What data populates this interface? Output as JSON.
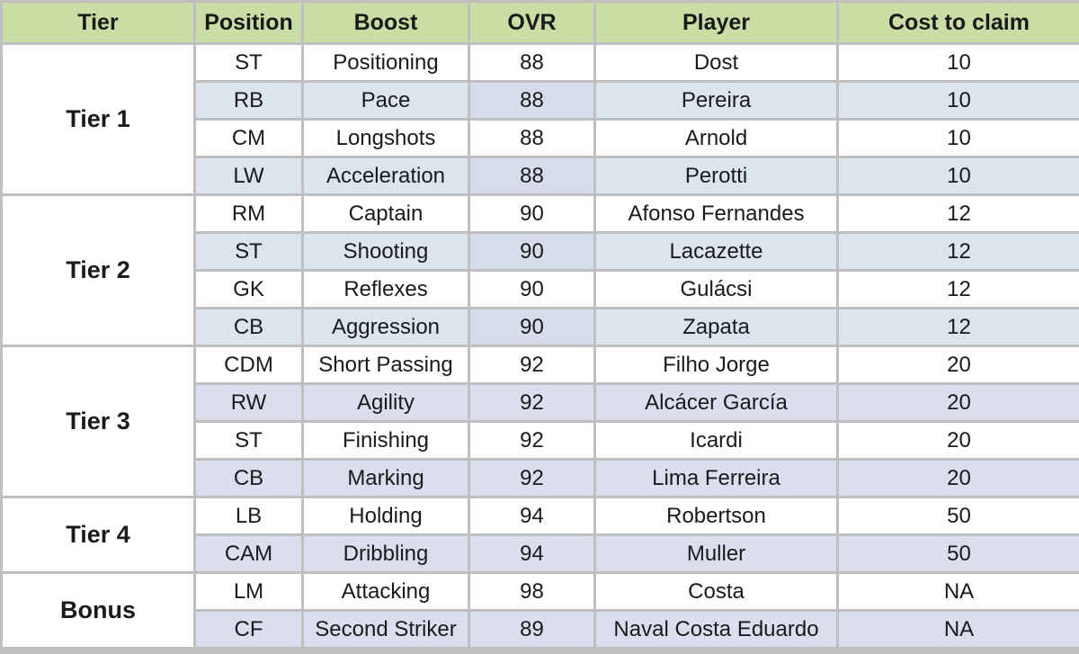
{
  "table": {
    "columns": [
      {
        "key": "tier",
        "label": "Tier"
      },
      {
        "key": "position",
        "label": "Position"
      },
      {
        "key": "boost",
        "label": "Boost"
      },
      {
        "key": "ovr",
        "label": "OVR"
      },
      {
        "key": "player",
        "label": "Player"
      },
      {
        "key": "cost",
        "label": "Cost to claim"
      }
    ],
    "header_bg": "#c9dda4",
    "grid_color": "#bfbfbf",
    "row_white_bg": "#ffffff",
    "row_alt_bg_tier12": "#dce4ed",
    "row_alt_bg_tier345": "#dadeef",
    "groups": [
      {
        "tier": "Tier 1",
        "rows": [
          {
            "position": "ST",
            "boost": "Positioning",
            "ovr": "88",
            "player": "Dost",
            "cost": "10"
          },
          {
            "position": "RB",
            "boost": "Pace",
            "ovr": "88",
            "player": "Pereira",
            "cost": "10"
          },
          {
            "position": "CM",
            "boost": "Longshots",
            "ovr": "88",
            "player": "Arnold",
            "cost": "10"
          },
          {
            "position": "LW",
            "boost": "Acceleration",
            "ovr": "88",
            "player": "Perotti",
            "cost": "10"
          }
        ]
      },
      {
        "tier": "Tier 2",
        "rows": [
          {
            "position": "RM",
            "boost": "Captain",
            "ovr": "90",
            "player": "Afonso Fernandes",
            "cost": "12"
          },
          {
            "position": "ST",
            "boost": "Shooting",
            "ovr": "90",
            "player": "Lacazette",
            "cost": "12"
          },
          {
            "position": "GK",
            "boost": "Reflexes",
            "ovr": "90",
            "player": "Gulácsi",
            "cost": "12"
          },
          {
            "position": "CB",
            "boost": "Aggression",
            "ovr": "90",
            "player": "Zapata",
            "cost": "12"
          }
        ]
      },
      {
        "tier": "Tier 3",
        "rows": [
          {
            "position": "CDM",
            "boost": "Short Passing",
            "ovr": "92",
            "player": "Filho Jorge",
            "cost": "20"
          },
          {
            "position": "RW",
            "boost": "Agility",
            "ovr": "92",
            "player": "Alcácer García",
            "cost": "20"
          },
          {
            "position": "ST",
            "boost": "Finishing",
            "ovr": "92",
            "player": "Icardi",
            "cost": "20"
          },
          {
            "position": "CB",
            "boost": "Marking",
            "ovr": "92",
            "player": "Lima Ferreira",
            "cost": "20"
          }
        ]
      },
      {
        "tier": "Tier 4",
        "rows": [
          {
            "position": "LB",
            "boost": "Holding",
            "ovr": "94",
            "player": "Robertson",
            "cost": "50"
          },
          {
            "position": "CAM",
            "boost": "Dribbling",
            "ovr": "94",
            "player": "Muller",
            "cost": "50"
          }
        ]
      },
      {
        "tier": "Bonus",
        "rows": [
          {
            "position": "LM",
            "boost": "Attacking",
            "ovr": "98",
            "player": "Costa",
            "cost": "NA"
          },
          {
            "position": "CF",
            "boost": "Second Striker",
            "ovr": "89",
            "player": "Naval Costa Eduardo",
            "cost": "NA"
          }
        ]
      }
    ]
  }
}
